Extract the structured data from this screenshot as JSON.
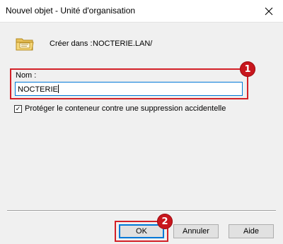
{
  "window": {
    "title": "Nouvel objet - Unité d'organisation",
    "close_glyph": "✕"
  },
  "header": {
    "create_in_label": "Créer dans :",
    "create_in_value": "NOCTERIE.LAN/",
    "icon": "ou-folder-icon"
  },
  "form": {
    "name_label": "Nom :",
    "name_value": "NOCTERIE",
    "protect_label": "Protéger le conteneur contre une suppression accidentelle",
    "protect_checked": true,
    "check_glyph": "✓"
  },
  "buttons": {
    "ok": "OK",
    "cancel": "Annuler",
    "help": "Aide"
  },
  "annotations": {
    "step1": "1",
    "step2": "2",
    "color": "#d32027"
  }
}
